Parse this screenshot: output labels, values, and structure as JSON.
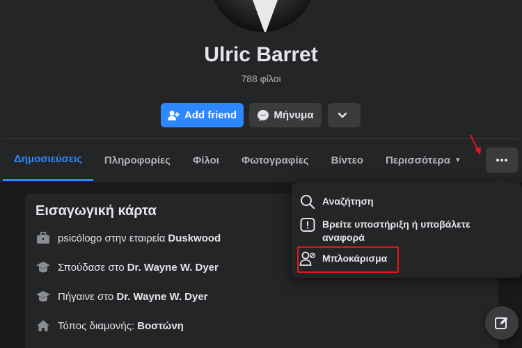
{
  "profile": {
    "name": "Ulric Barret",
    "friends_count": "788 φίλοι"
  },
  "actions": {
    "add_friend": "Add friend",
    "message": "Μήνυμα"
  },
  "tabs": [
    {
      "label": "Δημοσιεύσεις",
      "active": true
    },
    {
      "label": "Πληροφορίες"
    },
    {
      "label": "Φίλοι"
    },
    {
      "label": "Φωτογραφίες"
    },
    {
      "label": "Βίντεο"
    },
    {
      "label": "Περισσότερα"
    }
  ],
  "intro": {
    "title": "Εισαγωγική κάρτα",
    "items": [
      {
        "icon": "briefcase-icon",
        "text": "psicólogo στην εταιρεία",
        "bold": "Duskwood"
      },
      {
        "icon": "graduation-cap-icon",
        "text": "Σπούδασε στο",
        "bold": "Dr. Wayne W. Dyer"
      },
      {
        "icon": "graduation-cap-icon",
        "text": "Πήγαινε στο",
        "bold": "Dr. Wayne W. Dyer"
      },
      {
        "icon": "home-icon",
        "text": "Τόπος διαμονής:",
        "bold": "Βοστώνη"
      }
    ]
  },
  "menu": {
    "items": [
      {
        "icon": "search-icon",
        "label": "Αναζήτηση"
      },
      {
        "icon": "report-icon",
        "label": "Βρείτε υποστήριξη ή υποβάλετε αναφορά"
      },
      {
        "icon": "block-user-icon",
        "label": "Μπλοκάρισμα",
        "highlighted": true
      }
    ]
  },
  "colors": {
    "accent": "#2d88ff",
    "highlight_box": "#e0161e",
    "background": "#18191a",
    "surface": "#242526"
  }
}
